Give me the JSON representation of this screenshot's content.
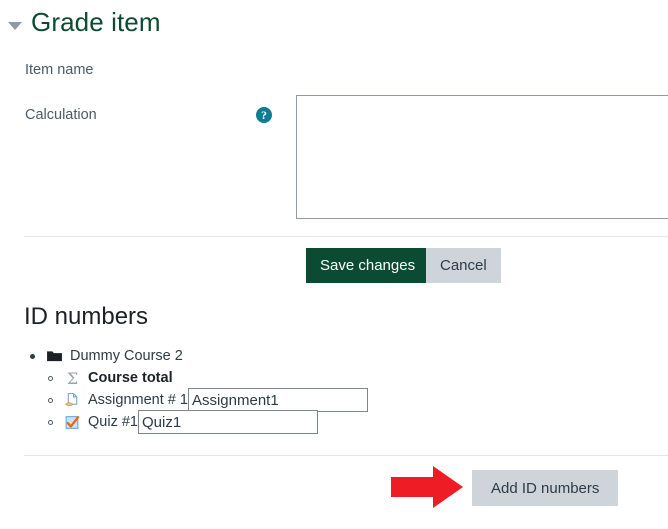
{
  "section": {
    "title": "Grade item",
    "collapse_icon": "caret-down-icon"
  },
  "form": {
    "item_name_label": "Item name",
    "calculation_label": "Calculation",
    "calculation_help_icon": "help-circle-icon",
    "calculation_value": "",
    "calculation_placeholder": ""
  },
  "actions": {
    "save_label": "Save changes",
    "cancel_label": "Cancel",
    "save_bg": "#0c4b33",
    "cancel_bg": "#ced4da"
  },
  "id_numbers": {
    "heading": "ID numbers",
    "tree": [
      {
        "label": "Dummy Course 2",
        "icon": "folder-icon",
        "level": 1,
        "bold": false,
        "has_input": false
      },
      {
        "label": "Course total",
        "icon": "sigma-icon",
        "icon_glyph": "Σ",
        "level": 2,
        "bold": true,
        "has_input": false
      },
      {
        "label": "Assignment # 1",
        "icon": "assignment-icon",
        "level": 2,
        "bold": false,
        "has_input": true,
        "input_value": "Assignment1"
      },
      {
        "label": "Quiz #1",
        "icon": "quiz-icon",
        "level": 2,
        "bold": false,
        "has_input": true,
        "input_value": "Quiz1"
      }
    ],
    "add_button_label": "Add ID numbers"
  },
  "annotation": {
    "arrow_icon": "red-arrow-right-icon",
    "arrow_color": "#ee1c25"
  }
}
